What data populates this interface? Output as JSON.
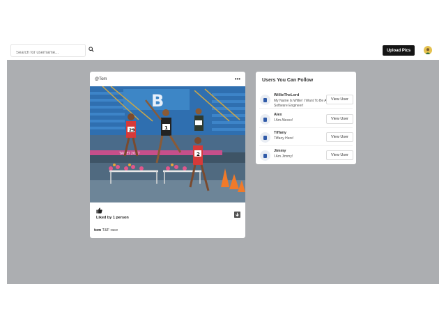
{
  "search": {
    "placeholder": "Search for username..."
  },
  "header": {
    "upload_label": "Upload Pics"
  },
  "post": {
    "username": "@Tom",
    "more_label": "•••",
    "likes_text": "Liked by 1 person",
    "caption_user": "tom",
    "caption_text": "T&F race"
  },
  "suggestions": {
    "title": "Users You Can Follow",
    "view_label": "View User",
    "users": [
      {
        "name": "WillieTheLord",
        "bio": "My Name Is Willie! I Want To Be A Software Engineer!"
      },
      {
        "name": "Alex",
        "bio": "I Am Alexxx!"
      },
      {
        "name": "Tiffany",
        "bio": "Tiffany Here!"
      },
      {
        "name": "Jimmy",
        "bio": "I Am Jimmy!"
      }
    ]
  },
  "colors": {
    "background": "#acaeb1",
    "button": "#151515",
    "card": "#ffffff"
  }
}
